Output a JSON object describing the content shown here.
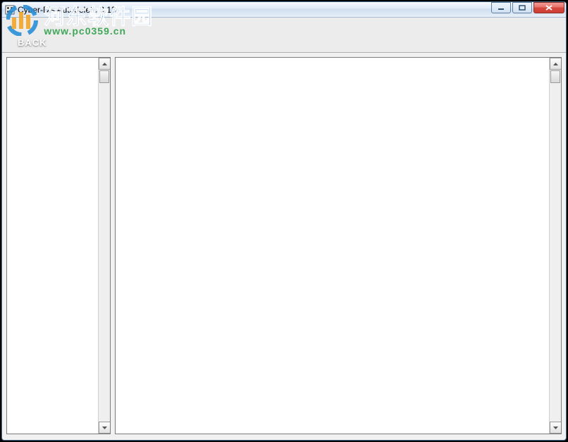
{
  "window": {
    "title": "Cyber-D's Autodelete 3.13"
  },
  "toolbar": {
    "back_label": "BACK"
  },
  "watermark": {
    "text_cn": "河东软件园",
    "url": "www.pc0359.cn"
  },
  "panes": {
    "left_items": [],
    "right_items": []
  }
}
